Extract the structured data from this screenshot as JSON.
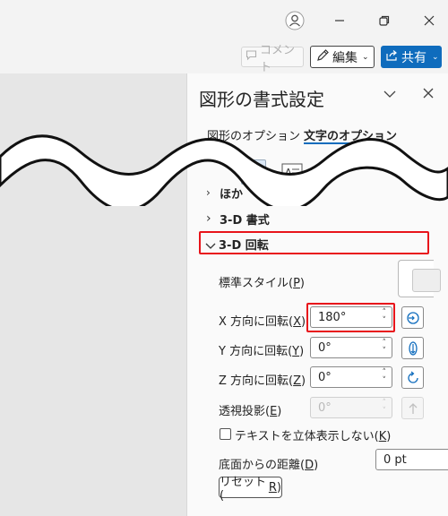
{
  "header": {
    "comment_label": "コメント",
    "edit_label": "編集",
    "share_label": "共有"
  },
  "pane": {
    "title": "図形の書式設定",
    "tabs": [
      {
        "label": "図形のオプション",
        "active": false
      },
      {
        "label": "文字のオプション",
        "active": true
      }
    ],
    "sections": {
      "other_label": "ほか",
      "format3d_label": "3-D 書式",
      "rotation3d_label": "3-D 回転"
    },
    "rotation": {
      "preset_label": "標準スタイル(",
      "preset_key": "P",
      "x_label": "X 方向に回転(",
      "x_key": "X",
      "x_value": "180°",
      "y_label": "Y 方向に回転(",
      "y_key": "Y",
      "y_value": "0°",
      "z_label": "Z 方向に回転(",
      "z_key": "Z",
      "z_value": "0°",
      "perspective_label": "透視投影(",
      "perspective_key": "E",
      "perspective_value": "0°",
      "keep_flat_label": "テキストを立体表示しない(",
      "keep_flat_key": "K",
      "keep_flat_checked": false,
      "distance_label": "底面からの距離(",
      "distance_key": "D",
      "distance_value": "0 pt",
      "reset_label": "リセット(",
      "reset_key": "R"
    }
  },
  "colors": {
    "accent": "#0f6cbd",
    "highlight": "#e8141b"
  }
}
